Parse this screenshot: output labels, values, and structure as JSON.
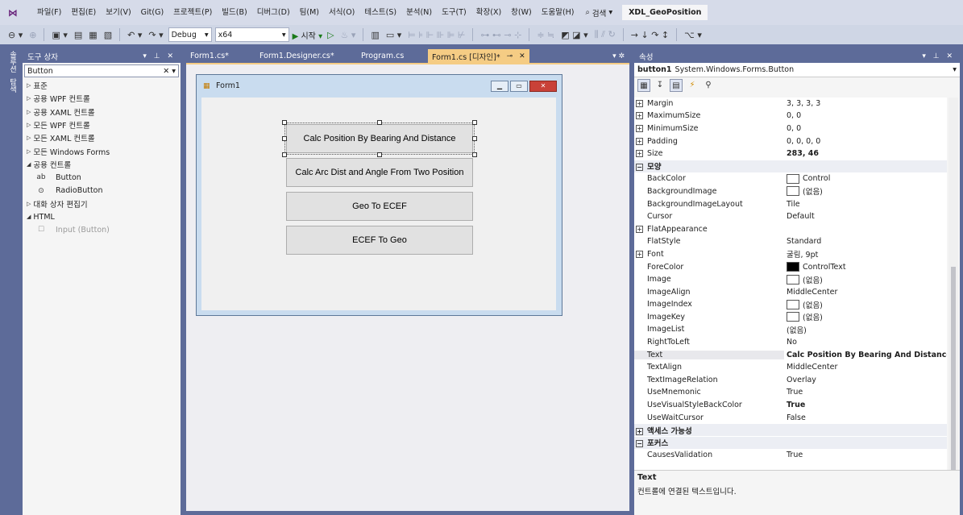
{
  "menu": {
    "items": [
      "파일(F)",
      "편집(E)",
      "보기(V)",
      "Git(G)",
      "프로젝트(P)",
      "빌드(B)",
      "디버그(D)",
      "팀(M)",
      "서식(O)",
      "테스트(S)",
      "분석(N)",
      "도구(T)",
      "확장(X)",
      "창(W)",
      "도움말(H)"
    ],
    "search_label": "검색",
    "project_title": "XDL_GeoPosition"
  },
  "toolbar": {
    "config": "Debug",
    "platform": "x64",
    "start_label": "시작"
  },
  "side_strip": {
    "tabs": [
      "솔루션",
      "탐색"
    ]
  },
  "toolbox": {
    "title": "도구 상자",
    "search_value": "Button",
    "items": [
      {
        "label": "표준",
        "type": "group",
        "expanded": false
      },
      {
        "label": "공용 WPF 컨트롤",
        "type": "group",
        "expanded": false
      },
      {
        "label": "공용 XAML 컨트롤",
        "type": "group",
        "expanded": false
      },
      {
        "label": "모든 WPF 컨트롤",
        "type": "group",
        "expanded": false
      },
      {
        "label": "모든 XAML 컨트롤",
        "type": "group",
        "expanded": false
      },
      {
        "label": "모든 Windows Forms",
        "type": "group",
        "expanded": false
      },
      {
        "label": "공용 컨트롤",
        "type": "group",
        "expanded": true
      },
      {
        "label": "Button",
        "type": "item",
        "icon": "ab"
      },
      {
        "label": "RadioButton",
        "type": "item",
        "icon": "⊙"
      },
      {
        "label": "대화 상자 편집기",
        "type": "group",
        "expanded": false
      },
      {
        "label": "HTML",
        "type": "group",
        "expanded": true
      },
      {
        "label": "Input (Button)",
        "type": "item-disabled",
        "icon": "☐"
      }
    ]
  },
  "tabs": [
    {
      "label": "Form1.cs*",
      "active": false
    },
    {
      "label": "Form1.Designer.cs*",
      "active": false
    },
    {
      "label": "Program.cs",
      "active": false
    },
    {
      "label": "Form1.cs [디자인]*",
      "active": true
    }
  ],
  "form": {
    "title": "Form1",
    "buttons": [
      "Calc Position By Bearing And Distance",
      "Calc Arc Dist and Angle From Two Position",
      "Geo To ECEF",
      "ECEF To Geo"
    ]
  },
  "properties": {
    "title": "속성",
    "object_name": "button1",
    "object_type": "System.Windows.Forms.Button",
    "rows": [
      {
        "name": "Margin",
        "value": "3, 3, 3, 3",
        "expander": true
      },
      {
        "name": "MaximumSize",
        "value": "0, 0",
        "expander": true
      },
      {
        "name": "MinimumSize",
        "value": "0, 0",
        "expander": true
      },
      {
        "name": "Padding",
        "value": "0, 0, 0, 0",
        "expander": true
      },
      {
        "name": "Size",
        "value": "283, 46",
        "expander": true,
        "bold": true
      },
      {
        "name": "모양",
        "category": true
      },
      {
        "name": "BackColor",
        "value": "Control",
        "swatch": "white"
      },
      {
        "name": "BackgroundImage",
        "value": "(없음)",
        "swatch": "white"
      },
      {
        "name": "BackgroundImageLayout",
        "value": "Tile"
      },
      {
        "name": "Cursor",
        "value": "Default"
      },
      {
        "name": "FlatAppearance",
        "value": "",
        "expander": true
      },
      {
        "name": "FlatStyle",
        "value": "Standard"
      },
      {
        "name": "Font",
        "value": "굴림, 9pt",
        "expander": true
      },
      {
        "name": "ForeColor",
        "value": "ControlText",
        "swatch": "black"
      },
      {
        "name": "Image",
        "value": "(없음)",
        "swatch": "white"
      },
      {
        "name": "ImageAlign",
        "value": "MiddleCenter"
      },
      {
        "name": "ImageIndex",
        "value": "(없음)",
        "swatch": "white"
      },
      {
        "name": "ImageKey",
        "value": "(없음)",
        "swatch": "white"
      },
      {
        "name": "ImageList",
        "value": "(없음)"
      },
      {
        "name": "RightToLeft",
        "value": "No"
      },
      {
        "name": "Text",
        "value": "Calc Position By Bearing And Distance",
        "bold": true,
        "selected": true
      },
      {
        "name": "TextAlign",
        "value": "MiddleCenter"
      },
      {
        "name": "TextImageRelation",
        "value": "Overlay"
      },
      {
        "name": "UseMnemonic",
        "value": "True"
      },
      {
        "name": "UseVisualStyleBackColor",
        "value": "True",
        "bold": true
      },
      {
        "name": "UseWaitCursor",
        "value": "False"
      },
      {
        "name": "액세스 가능성",
        "category": true,
        "collapsed": true
      },
      {
        "name": "포커스",
        "category": true
      },
      {
        "name": "CausesValidation",
        "value": "True"
      }
    ],
    "description_title": "Text",
    "description_text": "컨트롤에 연결된 텍스트입니다."
  }
}
